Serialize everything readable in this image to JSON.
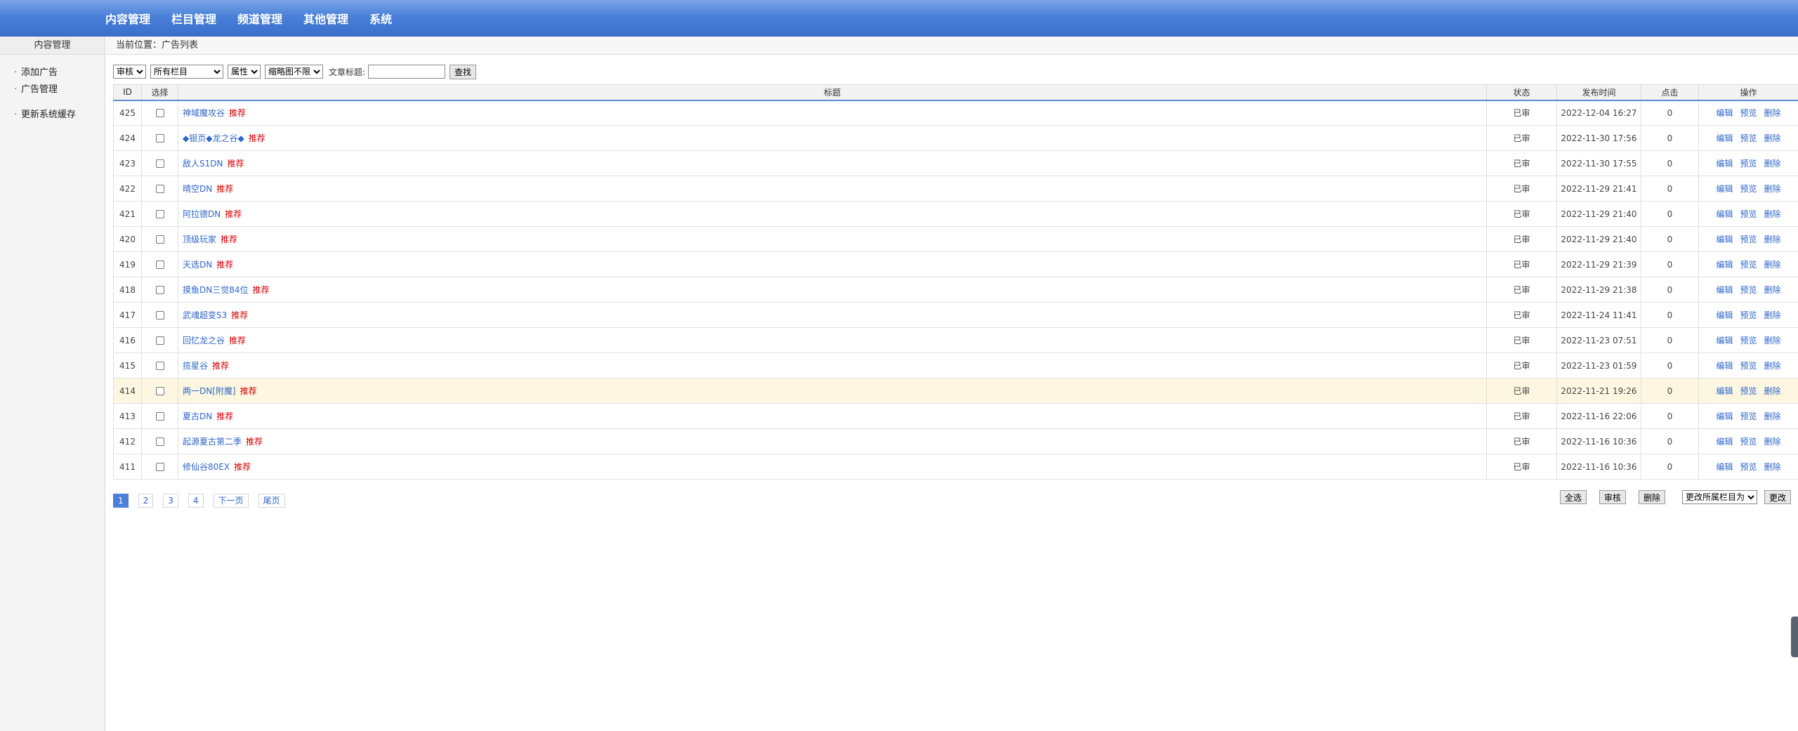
{
  "topnav": [
    "内容管理",
    "栏目管理",
    "频道管理",
    "其他管理",
    "系统"
  ],
  "sidebar": {
    "head": "内容管理",
    "items": [
      "添加广告",
      "广告管理",
      "更新系统缓存"
    ]
  },
  "crumb": "当前位置：广告列表",
  "filters": {
    "audit": "审核",
    "category": "所有栏目",
    "attr": "属性",
    "thumb": "缩略图不限",
    "title_label": "文章标题:",
    "title_value": "",
    "search_button": "查找"
  },
  "table": {
    "headers": [
      "ID",
      "选择",
      "标题",
      "状态",
      "发布时间",
      "点击",
      "操作"
    ],
    "ops": [
      "编辑",
      "预览",
      "删除"
    ],
    "rows": [
      {
        "id": "425",
        "title": "神域魔攻谷",
        "tag": "推荐",
        "status": "已审",
        "time": "2022-12-04 16:27",
        "clicks": "0"
      },
      {
        "id": "424",
        "title": "◆银页◆龙之谷◆",
        "tag": "推荐",
        "status": "已审",
        "time": "2022-11-30 17:56",
        "clicks": "0"
      },
      {
        "id": "423",
        "title": "敌人S1DN",
        "tag": "推荐",
        "status": "已审",
        "time": "2022-11-30 17:55",
        "clicks": "0"
      },
      {
        "id": "422",
        "title": "晴空DN",
        "tag": "推荐",
        "status": "已审",
        "time": "2022-11-29 21:41",
        "clicks": "0"
      },
      {
        "id": "421",
        "title": "阿拉德DN",
        "tag": "推荐",
        "status": "已审",
        "time": "2022-11-29 21:40",
        "clicks": "0"
      },
      {
        "id": "420",
        "title": "顶级玩家",
        "tag": "推荐",
        "status": "已审",
        "time": "2022-11-29 21:40",
        "clicks": "0"
      },
      {
        "id": "419",
        "title": "天选DN",
        "tag": "推荐",
        "status": "已审",
        "time": "2022-11-29 21:39",
        "clicks": "0"
      },
      {
        "id": "418",
        "title": "摸鱼DN三觉84位",
        "tag": "推荐",
        "status": "已审",
        "time": "2022-11-29 21:38",
        "clicks": "0"
      },
      {
        "id": "417",
        "title": "武魂超变S3",
        "tag": "推荐",
        "status": "已审",
        "time": "2022-11-24 11:41",
        "clicks": "0"
      },
      {
        "id": "416",
        "title": "回忆龙之谷",
        "tag": "推荐",
        "status": "已审",
        "time": "2022-11-23 07:51",
        "clicks": "0"
      },
      {
        "id": "415",
        "title": "揽星谷",
        "tag": "推荐",
        "status": "已审",
        "time": "2022-11-23 01:59",
        "clicks": "0"
      },
      {
        "id": "414",
        "title": "两一DN[附魔]",
        "tag": "推荐",
        "status": "已审",
        "time": "2022-11-21 19:26",
        "clicks": "0",
        "highlight": true
      },
      {
        "id": "413",
        "title": "夏古DN",
        "tag": "推荐",
        "status": "已审",
        "time": "2022-11-16 22:06",
        "clicks": "0"
      },
      {
        "id": "412",
        "title": "起源夏古第二季",
        "tag": "推荐",
        "status": "已审",
        "time": "2022-11-16 10:36",
        "clicks": "0"
      },
      {
        "id": "411",
        "title": "修仙谷80EX",
        "tag": "推荐",
        "status": "已审",
        "time": "2022-11-16 10:36",
        "clicks": "0"
      }
    ]
  },
  "pager": [
    "1",
    "2",
    "3",
    "4",
    "下一页",
    "尾页"
  ],
  "actions": {
    "select_all": "全选",
    "audit": "审核",
    "delete": "删除",
    "move_select": "更改所属栏目为",
    "change": "更改"
  }
}
